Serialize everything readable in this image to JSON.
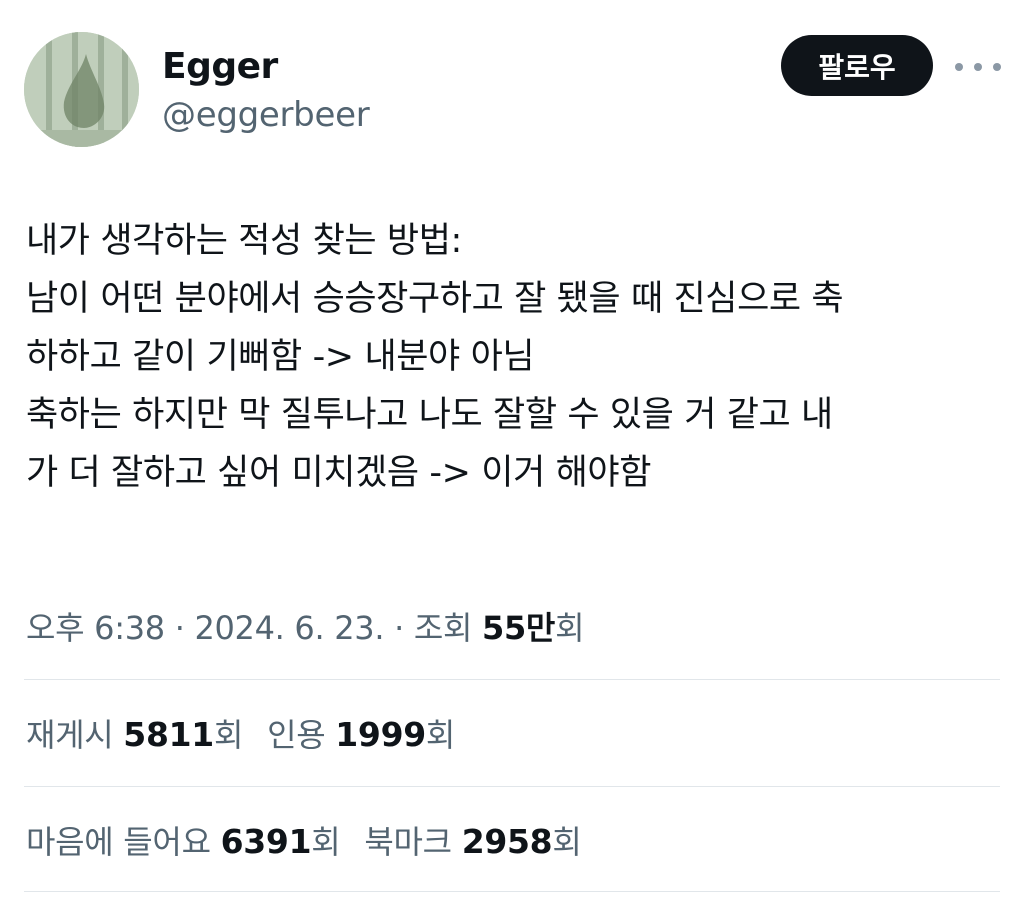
{
  "author": {
    "display_name": "Egger",
    "handle": "@eggerbeer"
  },
  "actions": {
    "follow_label": "팔로우",
    "more_icon": "more-horizontal-icon"
  },
  "tweet": {
    "lines": [
      "내가 생각하는 적성 찾는 방법:",
      "남이 어떤 분야에서 승승장구하고 잘 됐을 때 진심으로 축",
      "하하고 같이 기뻐함 -> 내분야 아님",
      "축하는 하지만 막 질투나고 나도 잘할 수 있을 거 같고 내",
      "가 더 잘하고 싶어 미치겠음 -> 이거 해야함"
    ]
  },
  "meta": {
    "time": "오후 6:38",
    "separator": "·",
    "date": "2024. 6. 23.",
    "views_label": "조회",
    "views_value": "55만",
    "views_suffix": "회"
  },
  "stats": {
    "reposts_label": "재게시",
    "reposts_value": "5811",
    "quotes_label": "인용",
    "quotes_value": "1999",
    "likes_label": "마음에 들어요",
    "likes_value": "6391",
    "bookmarks_label": "북마크",
    "bookmarks_value": "2958",
    "count_suffix": "회"
  },
  "colors": {
    "text_primary": "#0f1419",
    "text_secondary": "#536471",
    "button_bg": "#0f1419",
    "divider": "#e1e6ea"
  }
}
